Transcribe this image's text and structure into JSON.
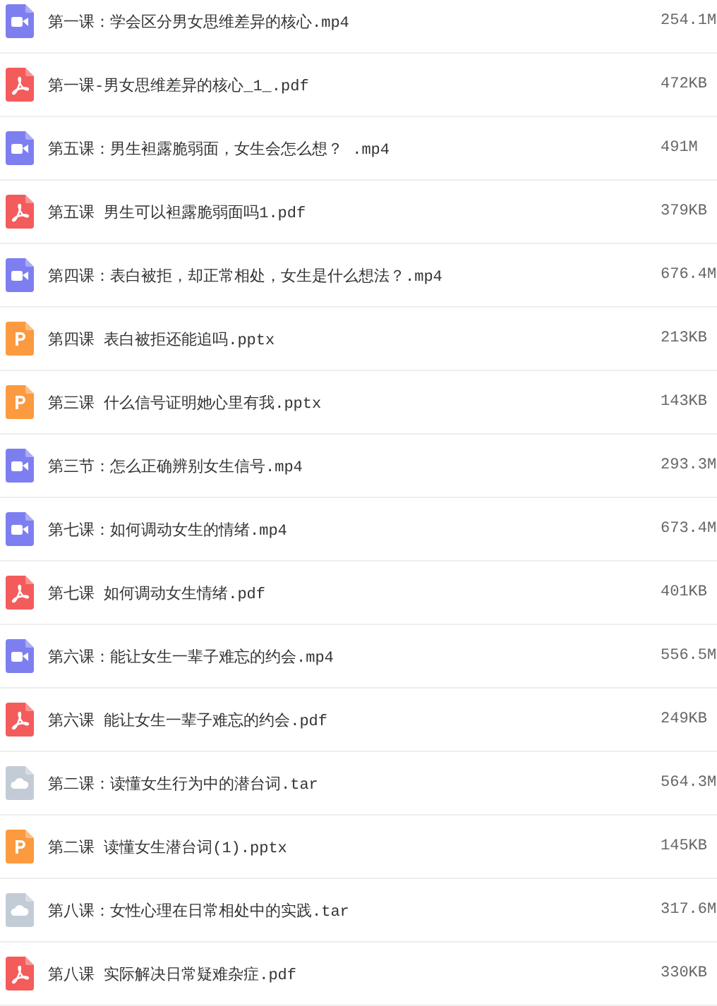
{
  "files": [
    {
      "kind": "video",
      "name": "第一课：学会区分男女思维差异的核心.mp4",
      "size": "254.1M"
    },
    {
      "kind": "pdf",
      "name": "第一课-男女思维差异的核心_1_.pdf",
      "size": "472KB"
    },
    {
      "kind": "video",
      "name": "第五课：男生袒露脆弱面，女生会怎么想？ .mp4",
      "size": "491M"
    },
    {
      "kind": "pdf",
      "name": "第五课 男生可以袒露脆弱面吗1.pdf",
      "size": "379KB"
    },
    {
      "kind": "video",
      "name": "第四课：表白被拒，却正常相处，女生是什么想法？.mp4",
      "size": "676.4M"
    },
    {
      "kind": "ppt",
      "name": "第四课 表白被拒还能追吗.pptx",
      "size": "213KB"
    },
    {
      "kind": "ppt",
      "name": "第三课 什么信号证明她心里有我.pptx",
      "size": "143KB"
    },
    {
      "kind": "video",
      "name": "第三节：怎么正确辨别女生信号.mp4",
      "size": "293.3M"
    },
    {
      "kind": "video",
      "name": "第七课：如何调动女生的情绪.mp4",
      "size": "673.4M"
    },
    {
      "kind": "pdf",
      "name": "第七课 如何调动女生情绪.pdf",
      "size": "401KB"
    },
    {
      "kind": "video",
      "name": "第六课：能让女生一辈子难忘的约会.mp4",
      "size": "556.5M"
    },
    {
      "kind": "pdf",
      "name": "第六课 能让女生一辈子难忘的约会.pdf",
      "size": "249KB"
    },
    {
      "kind": "archive",
      "name": "第二课：读懂女生行为中的潜台词.tar",
      "size": "564.3M"
    },
    {
      "kind": "ppt",
      "name": "第二课 读懂女生潜台词(1).pptx",
      "size": "145KB"
    },
    {
      "kind": "archive",
      "name": "第八课：女性心理在日常相处中的实践.tar",
      "size": "317.6M"
    },
    {
      "kind": "pdf",
      "name": "第八课 实际解决日常疑难杂症.pdf",
      "size": "330KB"
    }
  ]
}
